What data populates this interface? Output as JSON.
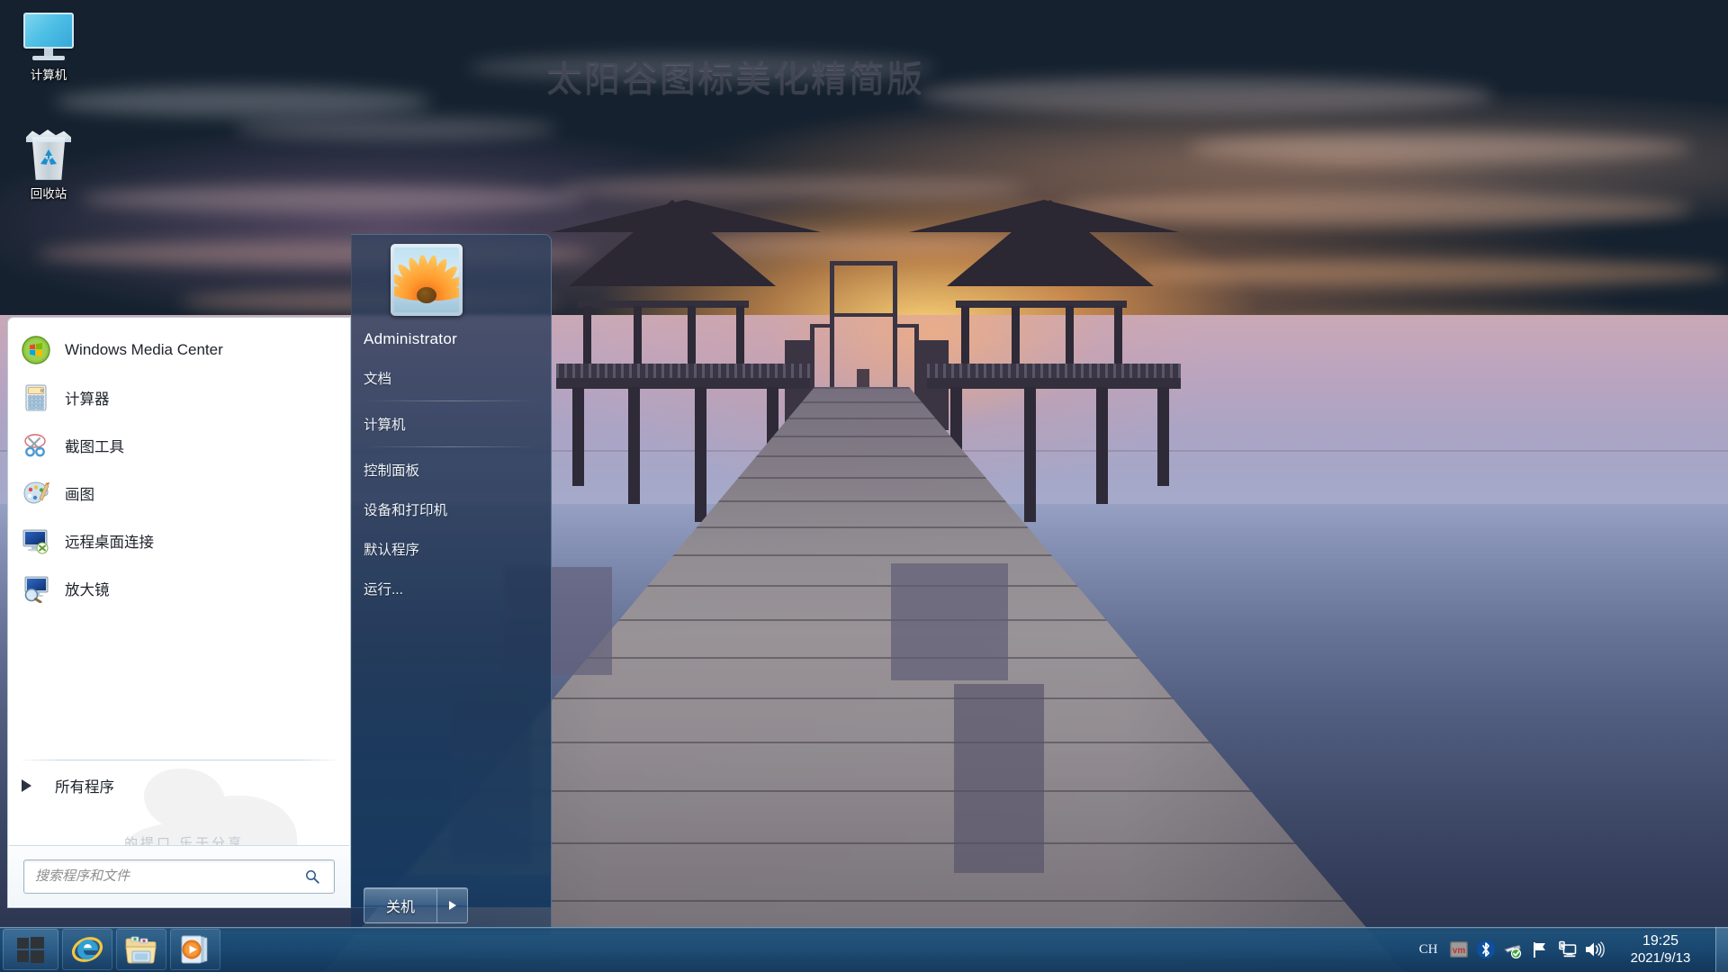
{
  "desktop": {
    "watermark": "太阳谷图标美化精简版",
    "icons": [
      {
        "label": "计算机",
        "icon": "computer-monitor-icon"
      },
      {
        "label": "回收站",
        "icon": "recycle-bin-icon"
      }
    ]
  },
  "start_menu": {
    "programs": [
      {
        "label": "Windows Media Center",
        "icon": "windows-media-center-icon"
      },
      {
        "label": "计算器",
        "icon": "calculator-icon"
      },
      {
        "label": "截图工具",
        "icon": "snipping-tool-icon"
      },
      {
        "label": "画图",
        "icon": "paint-icon"
      },
      {
        "label": "远程桌面连接",
        "icon": "remote-desktop-icon"
      },
      {
        "label": "放大镜",
        "icon": "magnifier-icon"
      }
    ],
    "all_programs_label": "所有程序",
    "search": {
      "placeholder": "搜索程序和文件",
      "value": "",
      "icon": "search-icon"
    },
    "user": {
      "name": "Administrator",
      "avatar": "flower-avatar"
    },
    "right_items": [
      "文档",
      "计算机",
      "控制面板",
      "设备和打印机",
      "默认程序",
      "运行..."
    ],
    "shutdown": {
      "label": "关机",
      "options_icon": "chevron-right-icon"
    },
    "watermark_text": "的提口 乐于分享"
  },
  "taskbar": {
    "start_icon": "windows-start-icon",
    "pinned": [
      {
        "name": "internet-explorer",
        "icon": "internet-explorer-icon"
      },
      {
        "name": "windows-explorer",
        "icon": "folder-icon"
      },
      {
        "name": "windows-media-player",
        "icon": "media-player-icon"
      }
    ],
    "tray": {
      "ime": "CH",
      "items": [
        {
          "name": "vmware-tray",
          "icon": "vm-icon"
        },
        {
          "name": "bluetooth-tray",
          "icon": "bluetooth-icon"
        },
        {
          "name": "safely-remove-hardware",
          "icon": "usb-eject-icon"
        },
        {
          "name": "action-center",
          "icon": "flag-icon"
        },
        {
          "name": "network",
          "icon": "network-monitor-icon"
        },
        {
          "name": "volume",
          "icon": "speaker-icon"
        }
      ]
    },
    "clock": {
      "time": "19:25",
      "date": "2021/9/13"
    }
  },
  "colors": {
    "taskbar": "#1a4a74",
    "start_right_panel": "#24364f",
    "accent": "#3b82c4"
  }
}
